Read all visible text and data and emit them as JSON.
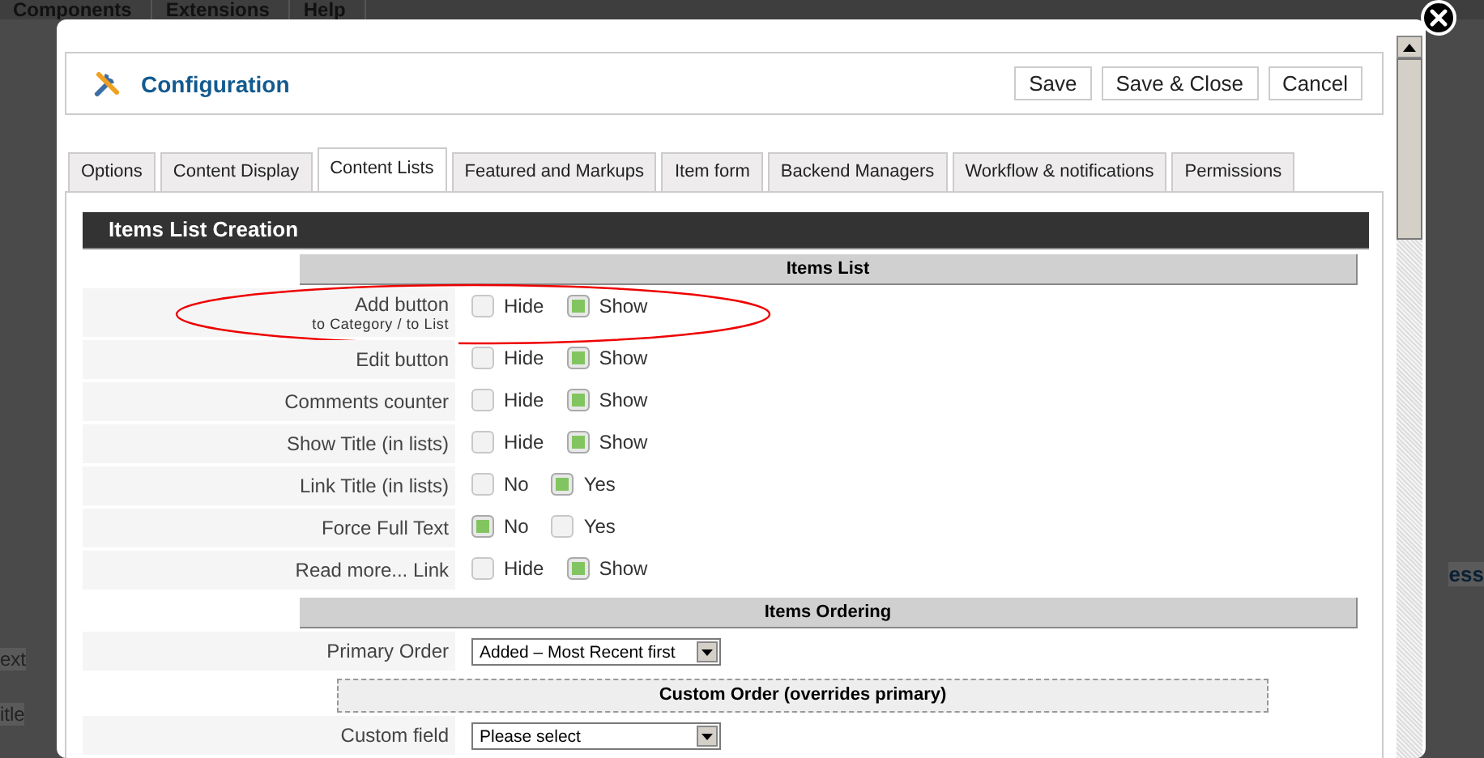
{
  "backdrop": {
    "menu": [
      "Components",
      "Extensions",
      "Help"
    ],
    "left_fragments": [
      "ext",
      "itle"
    ],
    "right_fragments": [
      "ess"
    ]
  },
  "dialog": {
    "title": "Configuration",
    "buttons": [
      "Save",
      "Save & Close",
      "Cancel"
    ]
  },
  "tabs": [
    {
      "label": "Options",
      "selected": false
    },
    {
      "label": "Content Display",
      "selected": false
    },
    {
      "label": "Content Lists",
      "selected": true
    },
    {
      "label": "Featured and Markups",
      "selected": false
    },
    {
      "label": "Item form",
      "selected": false
    },
    {
      "label": "Backend Managers",
      "selected": false
    },
    {
      "label": "Workflow & notifications",
      "selected": false
    },
    {
      "label": "Permissions",
      "selected": false
    }
  ],
  "section": {
    "title": "Items List Creation"
  },
  "rows": [
    {
      "kind": "header",
      "title": "Items List"
    },
    {
      "kind": "radio",
      "label": "Add button",
      "sublabel": "to Category / to List",
      "highlighted": true,
      "options": [
        {
          "label": "Hide",
          "selected": false
        },
        {
          "label": "Show",
          "selected": true
        }
      ]
    },
    {
      "kind": "radio",
      "label": "Edit button",
      "highlighted": false,
      "options": [
        {
          "label": "Hide",
          "selected": false
        },
        {
          "label": "Show",
          "selected": true
        }
      ]
    },
    {
      "kind": "radio",
      "label": "Comments counter",
      "highlighted": false,
      "options": [
        {
          "label": "Hide",
          "selected": false
        },
        {
          "label": "Show",
          "selected": true
        }
      ]
    },
    {
      "kind": "radio",
      "label": "Show Title (in lists)",
      "highlighted": false,
      "options": [
        {
          "label": "Hide",
          "selected": false
        },
        {
          "label": "Show",
          "selected": true
        }
      ]
    },
    {
      "kind": "radio",
      "label": "Link Title (in lists)",
      "highlighted": false,
      "options": [
        {
          "label": "No",
          "selected": false
        },
        {
          "label": "Yes",
          "selected": true
        }
      ]
    },
    {
      "kind": "radio",
      "label": "Force Full Text",
      "highlighted": false,
      "options": [
        {
          "label": "No",
          "selected": true
        },
        {
          "label": "Yes",
          "selected": false
        }
      ]
    },
    {
      "kind": "radio",
      "label": "Read more... Link",
      "highlighted": false,
      "options": [
        {
          "label": "Hide",
          "selected": false
        },
        {
          "label": "Show",
          "selected": true
        }
      ]
    },
    {
      "kind": "header",
      "title": "Items Ordering"
    },
    {
      "kind": "select",
      "label": "Primary Order",
      "value": "Added – Most Recent first"
    },
    {
      "kind": "subheader",
      "title": "Custom Order (overrides primary)"
    },
    {
      "kind": "select",
      "label": "Custom field",
      "value": "Please select"
    }
  ]
}
